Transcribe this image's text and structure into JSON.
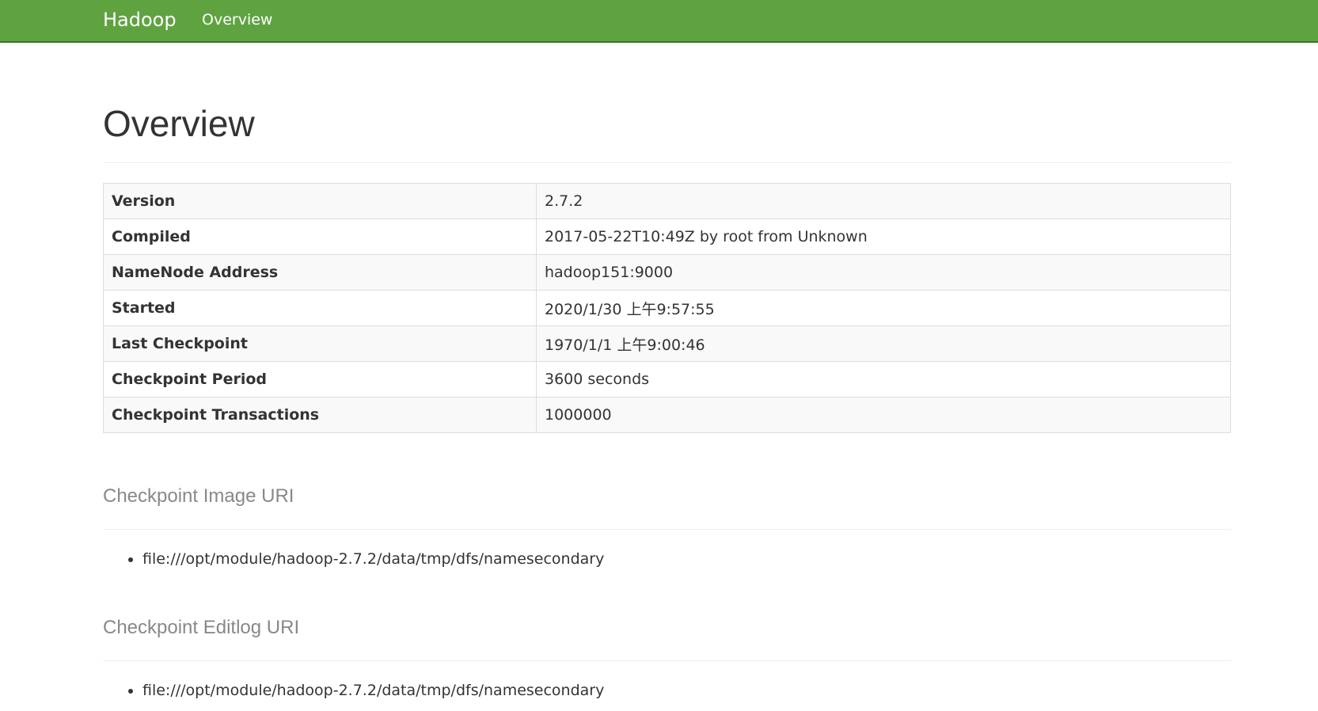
{
  "navbar": {
    "brand": "Hadoop",
    "links": [
      "Overview"
    ],
    "color": "#5fa341"
  },
  "page": {
    "title": "Overview"
  },
  "info_table": {
    "rows": [
      {
        "label": "Version",
        "value": "2.7.2"
      },
      {
        "label": "Compiled",
        "value": "2017-05-22T10:49Z by root from Unknown"
      },
      {
        "label": "NameNode Address",
        "value": "hadoop151:9000"
      },
      {
        "label": "Started",
        "value": "2020/1/30 上午9:57:55"
      },
      {
        "label": "Last Checkpoint",
        "value": "1970/1/1 上午9:00:46"
      },
      {
        "label": "Checkpoint Period",
        "value": "3600 seconds"
      },
      {
        "label": "Checkpoint Transactions",
        "value": "1000000"
      }
    ]
  },
  "checkpoint_image": {
    "title": "Checkpoint Image URI",
    "uris": [
      "file:///opt/module/hadoop-2.7.2/data/tmp/dfs/namesecondary"
    ]
  },
  "checkpoint_editlog": {
    "title": "Checkpoint Editlog URI",
    "uris": [
      "file:///opt/module/hadoop-2.7.2/data/tmp/dfs/namesecondary"
    ]
  }
}
